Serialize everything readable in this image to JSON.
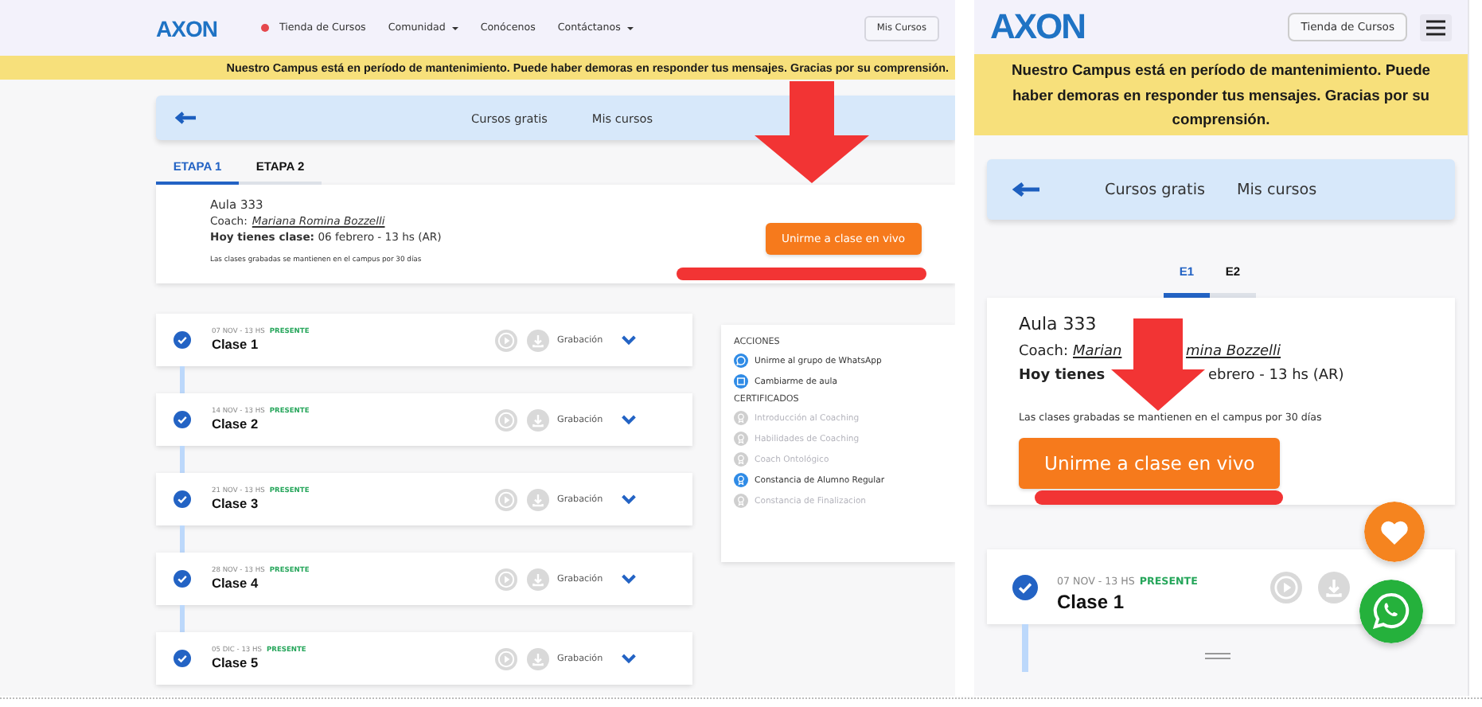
{
  "desktop": {
    "header": {
      "logo": "AXON",
      "nav": [
        {
          "label": "Tienda de Cursos",
          "dot": true,
          "dropdown": false
        },
        {
          "label": "Comunidad",
          "dot": false,
          "dropdown": true
        },
        {
          "label": "Conócenos",
          "dot": false,
          "dropdown": false
        },
        {
          "label": "Contáctanos",
          "dot": false,
          "dropdown": true
        }
      ],
      "button": "Mis Cursos"
    },
    "banner": "Nuestro Campus está en período de mantenimiento. Puede haber demoras en responder tus mensajes. Gracias por su comprensión.",
    "subnav": [
      "Cursos gratis",
      "Mis cursos"
    ],
    "tabs": [
      {
        "label": "ETAPA 1",
        "selected": true
      },
      {
        "label": "ETAPA 2",
        "selected": false
      }
    ],
    "course": {
      "room": "Aula 333",
      "coach_label": "Coach:",
      "coach": "Mariana Romina Bozzelli",
      "today": "**Hoy tienes clase:** 06 febrero - 13 hs (AR)",
      "note": "Las clases grabadas se mantienen en el campus por 30 días",
      "button": "Unirme a clase en vivo"
    },
    "classes": [
      {
        "date": "07 NOV - 13 HS",
        "status": "PRESENTE",
        "title": "Clase 1",
        "recording": "Grabación",
        "attended": true
      },
      {
        "date": "14 NOV - 13 HS",
        "status": "PRESENTE",
        "title": "Clase 2",
        "recording": "Grabación",
        "attended": true
      },
      {
        "date": "21 NOV - 13 HS",
        "status": "PRESENTE",
        "title": "Clase 3",
        "recording": "Grabación",
        "attended": true
      },
      {
        "date": "28 NOV - 13 HS",
        "status": "PRESENTE",
        "title": "Clase 4",
        "recording": "Grabación",
        "attended": true
      },
      {
        "date": "05 DIC - 13 HS",
        "status": "PRESENTE",
        "title": "Clase 5",
        "recording": "Grabación",
        "attended": true
      }
    ],
    "sidebar": [
      {
        "title": "ACCIONES",
        "items": [
          {
            "label": "Unirme al grupo de WhatsApp",
            "kind": "whatsapp",
            "enabled": true
          },
          {
            "label": "Cambiarme de aula",
            "kind": "calendar",
            "enabled": true
          }
        ]
      },
      {
        "title": "CERTIFICADOS",
        "items": [
          {
            "label": "Introducción al Coaching",
            "kind": "certificate",
            "enabled": false
          },
          {
            "label": "Habilidades de Coaching",
            "kind": "certificate",
            "enabled": false
          },
          {
            "label": "Coach Ontológico",
            "kind": "certificate",
            "enabled": false
          },
          {
            "label": "Constancia de Alumno Regular",
            "kind": "certificate",
            "enabled": true
          },
          {
            "label": "Constancia de Finalizacion",
            "kind": "certificate",
            "enabled": false
          }
        ]
      }
    ]
  },
  "mobile": {
    "header": {
      "logo": "AXON",
      "button": "Tienda de Cursos"
    },
    "banner": "Nuestro Campus está en período de mantenimiento. Puede haber demoras en responder tus mensajes. Gracias por su comprensión.",
    "subnav": [
      "Cursos gratis",
      "Mis cursos"
    ],
    "tabs": [
      {
        "label": "E1",
        "selected": true
      },
      {
        "label": "E2",
        "selected": false
      }
    ],
    "course": {
      "room": "Aula 333",
      "coach_label": "Coach:",
      "coach_parts": [
        "Marian",
        "mina Bozzelli"
      ],
      "today_parts": [
        "Hoy tienes",
        "ebrero - 13 hs (AR)"
      ],
      "note": "Las clases grabadas se mantienen en el campus por 30 días",
      "button": "Unirme a clase en vivo"
    },
    "classes": [
      {
        "date": "07 NOV - 13 HS",
        "status": "PRESENTE",
        "title": "Clase 1",
        "attended": true
      }
    ]
  }
}
